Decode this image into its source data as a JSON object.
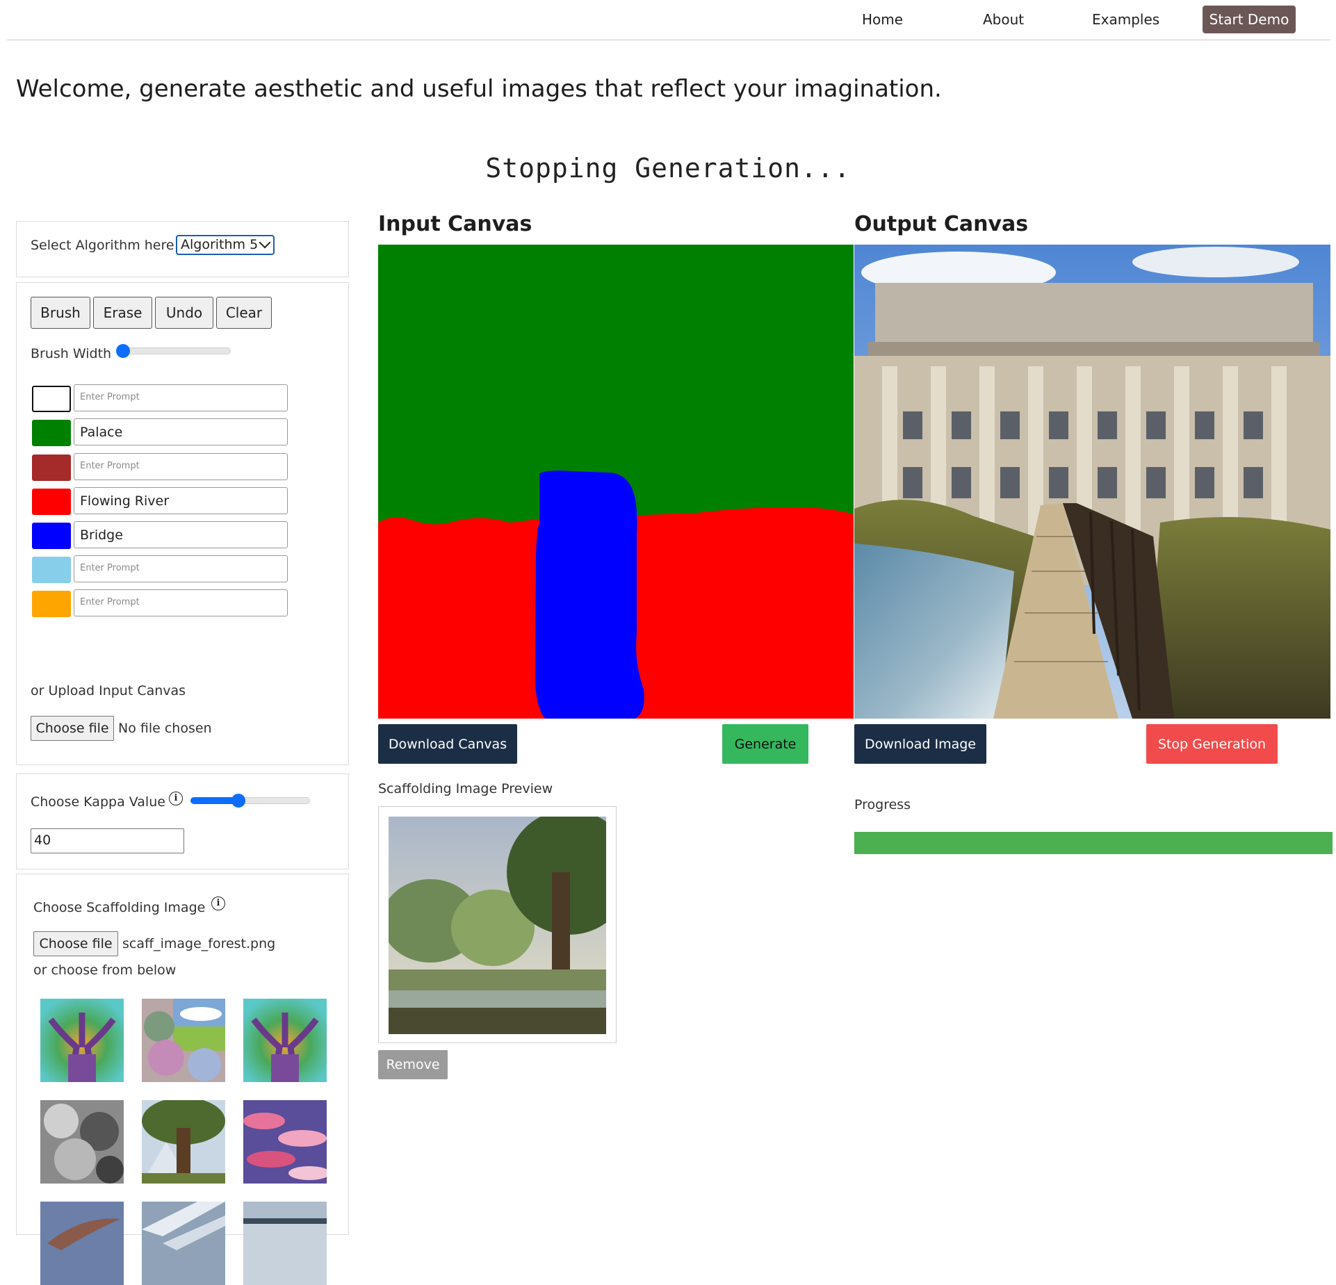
{
  "nav": {
    "home": "Home",
    "about": "About",
    "examples": "Examples",
    "start_demo": "Start Demo"
  },
  "welcome": "Welcome, generate aesthetic and useful images that reflect your imagination.",
  "status_message": "Stopping Generation...",
  "algorithm": {
    "label": "Select Algorithm here",
    "selected": "Algorithm 5"
  },
  "tools": {
    "brush": "Brush",
    "erase": "Erase",
    "undo": "Undo",
    "clear": "Clear",
    "brush_width_label": "Brush Width",
    "brush_width_level": 0.02
  },
  "prompts": [
    {
      "color": "#ffffff",
      "value": "",
      "placeholder": "Enter Prompt"
    },
    {
      "color": "#008000",
      "value": "Palace",
      "placeholder": "Enter Prompt"
    },
    {
      "color": "#a52a2a",
      "value": "",
      "placeholder": "Enter Prompt"
    },
    {
      "color": "#ff0000",
      "value": "Flowing River",
      "placeholder": "Enter Prompt"
    },
    {
      "color": "#0000ff",
      "value": "Bridge",
      "placeholder": "Enter Prompt"
    },
    {
      "color": "#87ceeb",
      "value": "",
      "placeholder": "Enter Prompt"
    },
    {
      "color": "#ffa500",
      "value": "",
      "placeholder": "Enter Prompt"
    }
  ],
  "upload": {
    "label": "or Upload Input Canvas",
    "button": "Choose file",
    "status": "No file chosen"
  },
  "kappa": {
    "label": "Choose Kappa Value",
    "value": "40",
    "slider_level": 0.4
  },
  "scaffold": {
    "label": "Choose Scaffolding Image",
    "button": "Choose file",
    "file_name": "scaff_image_forest.png",
    "or_label": "or choose from below",
    "thumbnails": [
      "tree-vivid",
      "cloud-collage",
      "tree-vivid-2",
      "storm-clouds",
      "big-tree-mountain",
      "pink-clouds",
      "dolphin",
      "sky-streaks",
      "coastline"
    ]
  },
  "input_canvas": {
    "title": "Input Canvas",
    "download": "Download Canvas",
    "generate": "Generate"
  },
  "output_canvas": {
    "title": "Output Canvas",
    "download": "Download Image",
    "stop": "Stop Generation"
  },
  "preview": {
    "label": "Scaffolding Image Preview",
    "remove": "Remove"
  },
  "progress": {
    "label": "Progress",
    "value": 1.0
  },
  "colors": {
    "nav_button": "#6c5757",
    "dark_button": "#1b2e45",
    "generate_green": "#35b75e",
    "stop_red": "#f24b4b",
    "progress_green": "#4caf50",
    "slider_blue": "#0d6efd"
  }
}
